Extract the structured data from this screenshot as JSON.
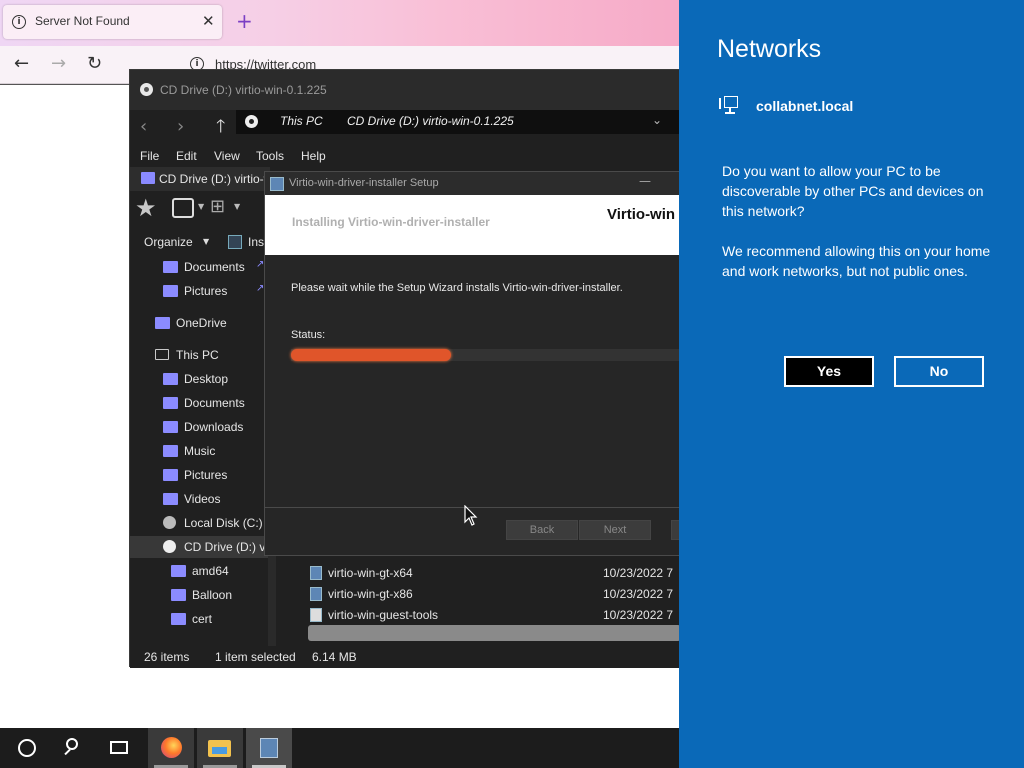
{
  "browser": {
    "tab_title": "Server Not Found",
    "tab_close": "✕",
    "new_tab": "+",
    "back": "←",
    "forward": "→",
    "reload": "↻",
    "url": "https://twitter.com",
    "tab_gradient_accent": "#f6aac7"
  },
  "explorer": {
    "title": "CD Drive (D:) virtio-win-0.1.225",
    "breadcrumb": [
      "This PC",
      "CD Drive (D:) virtio-win-0.1.225"
    ],
    "menu": [
      "File",
      "Edit",
      "View",
      "Tools",
      "Help"
    ],
    "tab_label": "CD Drive (D:) virtio-wi",
    "organize": "Organize",
    "install_label": "Ins",
    "nav": [
      {
        "label": "Documents",
        "pinned": true
      },
      {
        "label": "Pictures",
        "pinned": true
      },
      {
        "label": "OneDrive"
      },
      {
        "label": "This PC"
      },
      {
        "label": "Desktop"
      },
      {
        "label": "Documents"
      },
      {
        "label": "Downloads"
      },
      {
        "label": "Music"
      },
      {
        "label": "Pictures"
      },
      {
        "label": "Videos"
      },
      {
        "label": "Local Disk (C:)"
      },
      {
        "label": "CD Drive (D:) vi",
        "selected": true
      },
      {
        "label": "amd64"
      },
      {
        "label": "Balloon"
      },
      {
        "label": "cert"
      }
    ],
    "files": [
      {
        "name": "virtio-win-gt-x64",
        "date": "10/23/2022 7"
      },
      {
        "name": "virtio-win-gt-x86",
        "date": "10/23/2022 7"
      },
      {
        "name": "virtio-win-guest-tools",
        "date": "10/23/2022 7"
      }
    ],
    "status": {
      "items": "26 items",
      "selected": "1 item selected",
      "size": "6.14 MB"
    }
  },
  "setup": {
    "title": "Virtio-win-driver-installer Setup",
    "heading": "Installing Virtio-win-driver-installer",
    "brand": "Virtio-win",
    "description": "Please wait while the Setup Wizard installs Virtio-win-driver-installer.",
    "status_label": "Status:",
    "progress": 0.41,
    "progress_color": "#e0552a",
    "back": "Back",
    "next": "Next"
  },
  "networks": {
    "title": "Networks",
    "network_name": "collabnet.local",
    "question": "Do you want to allow your PC to be discoverable by other PCs and devices on this network?",
    "recommendation": "We recommend allowing this on your home and work networks, but not public ones.",
    "yes": "Yes",
    "no": "No",
    "panel_color": "#0a69b8"
  },
  "taskbar": {
    "items": [
      "start-icon",
      "search-icon",
      "task-view-icon",
      "firefox-icon",
      "file-explorer-icon",
      "setup-icon"
    ]
  }
}
